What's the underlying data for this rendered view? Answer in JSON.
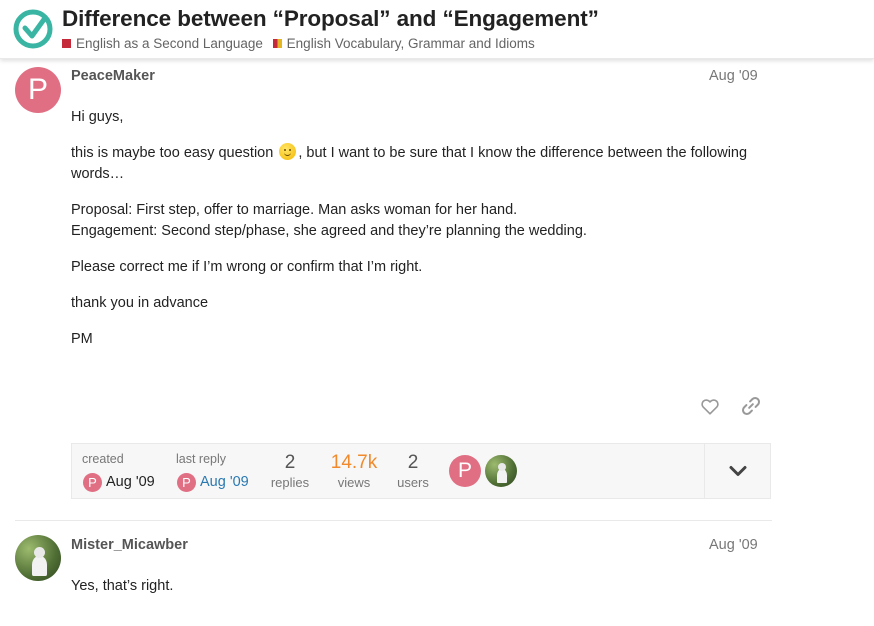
{
  "topic": {
    "title": "Difference between “Proposal” and “Engagement”",
    "categories": [
      {
        "label": "English as a Second Language",
        "color": "#c42a3a"
      },
      {
        "label": "English Vocabulary, Grammar and Idioms",
        "color": "#e5b623"
      }
    ]
  },
  "post1": {
    "avatar_letter": "P",
    "username": "PeaceMaker",
    "date": "Aug '09",
    "greeting": "Hi guys,",
    "line2_before": "this is maybe too easy question",
    "line2_after": ", but I want to be sure that I know the difference between the following words…",
    "proposal_line": "Proposal: First step, offer to marriage. Man asks woman for her hand.",
    "engagement_line": "Engagement: Second step/phase, she agreed and they’re planning the wedding.",
    "correct_line": "Please correct me if I’m wrong or confirm that I’m right.",
    "thanks_line": "thank you in advance",
    "signature": "PM",
    "actions": {
      "like_icon": "heart-icon",
      "share_icon": "link-icon"
    }
  },
  "topic_map": {
    "created_label": "created",
    "created_avatar_letter": "P",
    "created_date": "Aug '09",
    "last_reply_label": "last reply",
    "last_reply_avatar_letter": "P",
    "last_reply_date": "Aug '09",
    "replies_count": "2",
    "replies_label": "replies",
    "views_count": "14.7k",
    "views_label": "views",
    "users_count": "2",
    "users_label": "users",
    "participant_letter": "P",
    "expand_icon": "chevron-down-icon"
  },
  "post2": {
    "username": "Mister_Micawber",
    "date": "Aug '09",
    "text": "Yes, that’s right."
  },
  "colors": {
    "accent": "#2978b0",
    "views": "#f08a2c",
    "avatar": "#e06f84",
    "logo": "#3ab5a3"
  }
}
